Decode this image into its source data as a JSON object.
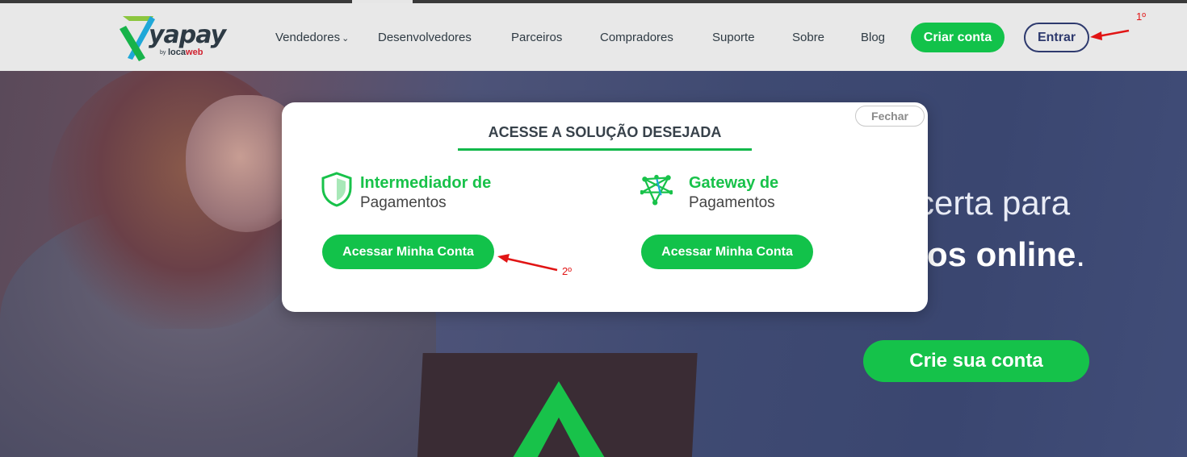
{
  "header": {
    "logo": {
      "name": "yapay",
      "by": "by",
      "brand_a": "loca",
      "brand_b": "web"
    },
    "nav": [
      {
        "label": "Vendedores",
        "has_dropdown": true
      },
      {
        "label": "Desenvolvedores"
      },
      {
        "label": "Parceiros"
      },
      {
        "label": "Compradores"
      },
      {
        "label": "Suporte"
      },
      {
        "label": "Sobre"
      },
      {
        "label": "Blog"
      }
    ],
    "criar_conta_label": "Criar conta",
    "entrar_label": "Entrar"
  },
  "annotations": {
    "first": "1º",
    "second": "2º"
  },
  "modal": {
    "close_label": "Fechar",
    "title": "ACESSE A SOLUÇÃO DESEJADA",
    "solutions": [
      {
        "title": "Intermediador de",
        "subtitle": "Pagamentos",
        "button_label": "Acessar Minha Conta",
        "icon": "shield-icon"
      },
      {
        "title": "Gateway de",
        "subtitle": "Pagamentos",
        "button_label": "Acessar Minha Conta",
        "icon": "network-icon"
      }
    ]
  },
  "hero": {
    "line1": "certa para",
    "line2_bold": "os online",
    "line2_end": ".",
    "cta_label": "Crie sua conta"
  },
  "colors": {
    "brand_green": "#12c24a",
    "navy": "#2e3a6e",
    "annotation_red": "#e11414"
  }
}
